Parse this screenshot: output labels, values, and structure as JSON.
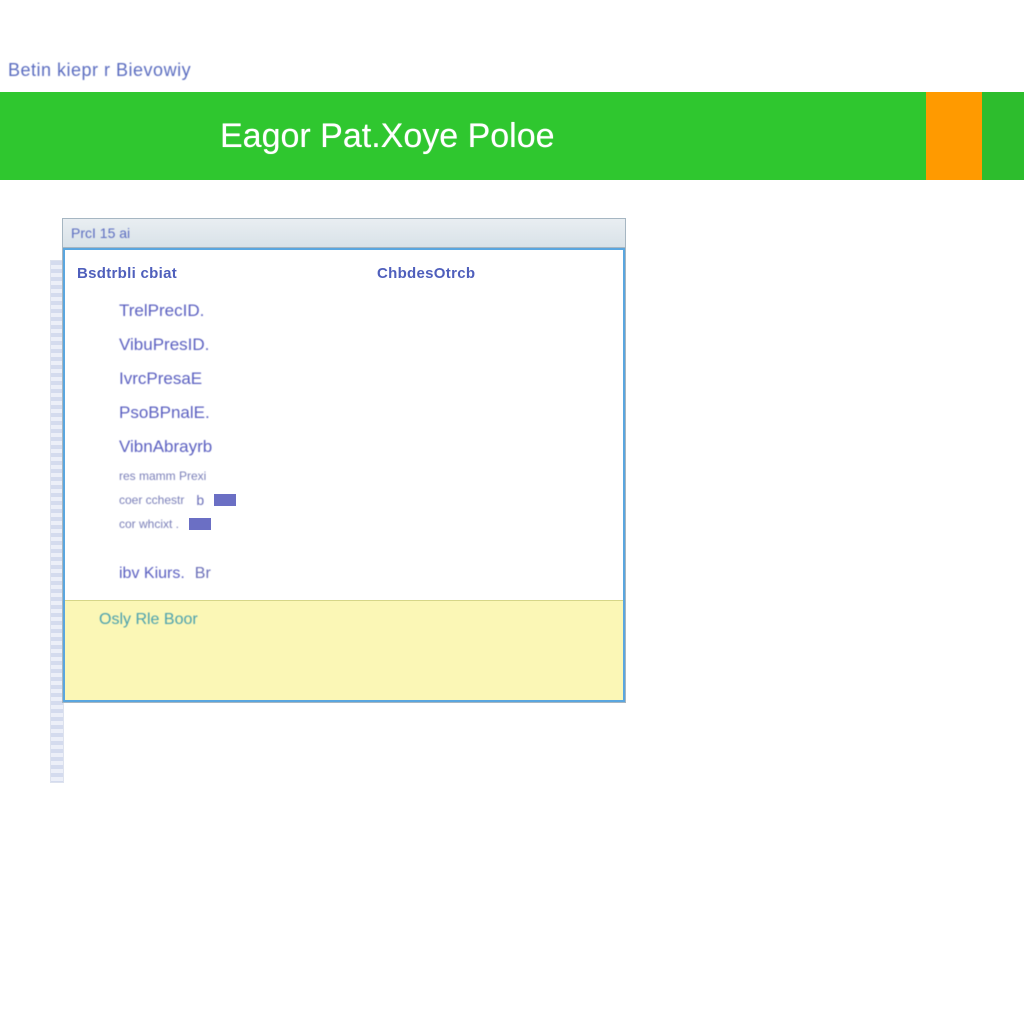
{
  "page": {
    "small_heading": "Betin kiepr r Bievowiy"
  },
  "banner": {
    "title": "Eagor Pat.Xoye Poloe"
  },
  "dialog": {
    "caption": "PrcI 15 ai",
    "columns": {
      "left": "Bsdtrbli cbiat",
      "right": "ChbdesOtrcb"
    },
    "properties": {
      "items": [
        {
          "label": "TrelPrecID."
        },
        {
          "label": "VibuPresID."
        },
        {
          "label": "IvrcPresaE"
        },
        {
          "label": "PsoBPnalE."
        },
        {
          "label": "VibnAbrayrb"
        }
      ],
      "small": [
        {
          "label": "res mamm Prexi",
          "value": ""
        },
        {
          "label": "coer cchestr",
          "value": "b",
          "swatch": true
        },
        {
          "label": "cor whcixt .",
          "value": "",
          "swatch": true
        }
      ],
      "last": {
        "label": "ibv Kiurs.",
        "glyph": "Br"
      }
    },
    "description": "Osly Rle Boor"
  }
}
